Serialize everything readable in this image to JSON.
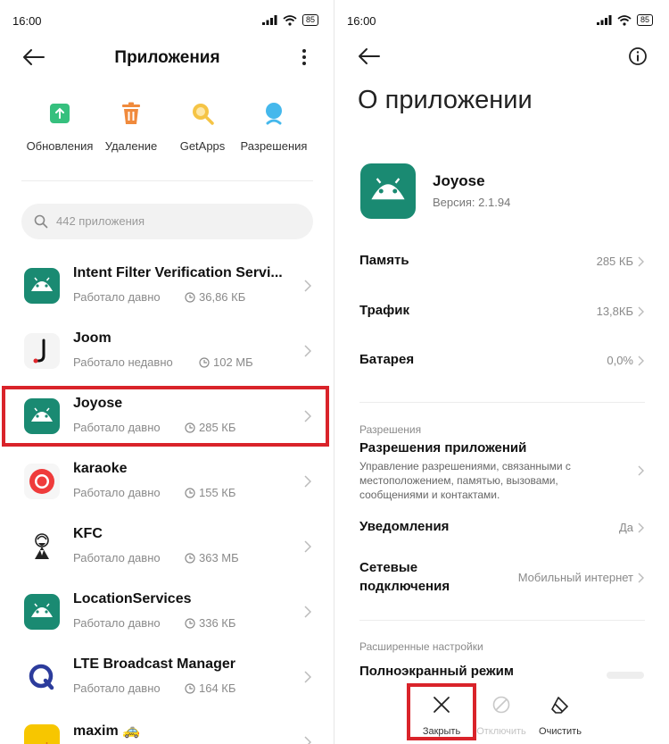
{
  "status_bar": {
    "time": "16:00",
    "battery": "85"
  },
  "left": {
    "title": "Приложения",
    "quick_actions": [
      {
        "label": "Обновления",
        "icon": "update-icon",
        "color": "#36c07e"
      },
      {
        "label": "Удаление",
        "icon": "trash-icon",
        "color": "#f08a3c"
      },
      {
        "label": "GetApps",
        "icon": "getapps-icon",
        "color": "#f5c445"
      },
      {
        "label": "Разрешения",
        "icon": "permissions-icon",
        "color": "#45b8ec"
      }
    ],
    "search_placeholder": "442 приложения",
    "apps": [
      {
        "name": "Intent Filter Verification Servi...",
        "status": "Работало давно",
        "size": "36,86 КБ",
        "icon": "android-icon"
      },
      {
        "name": "Joom",
        "status": "Работало недавно",
        "size": "102 МБ",
        "icon": "joom-icon"
      },
      {
        "name": "Joyose",
        "status": "Работало давно",
        "size": "285 КБ",
        "icon": "android-icon"
      },
      {
        "name": "karaoke",
        "status": "Работало давно",
        "size": "155 КБ",
        "icon": "karaoke-icon"
      },
      {
        "name": "KFC",
        "status": "Работало давно",
        "size": "363 МБ",
        "icon": "kfc-icon"
      },
      {
        "name": "LocationServices",
        "status": "Работало давно",
        "size": "336 КБ",
        "icon": "android-icon"
      },
      {
        "name": "LTE Broadcast Manager",
        "status": "Работало давно",
        "size": "164 КБ",
        "icon": "lte-icon"
      },
      {
        "name": "maxim 🚕",
        "status": "",
        "size": "",
        "icon": "maxim-icon",
        "logo_text": "maxim"
      }
    ]
  },
  "right": {
    "title": "О приложении",
    "app_name": "Joyose",
    "app_version": "Версия: 2.1.94",
    "rows": [
      {
        "label": "Память",
        "value": "285 КБ"
      },
      {
        "label": "Трафик",
        "value": "13,8КБ"
      },
      {
        "label": "Батарея",
        "value": "0,0%"
      }
    ],
    "permissions_section": "Разрешения",
    "permissions_title": "Разрешения приложений",
    "permissions_desc": "Управление разрешениями, связанными с местоположением, памятью, вызовами, сообщениями и контактами.",
    "notifications": {
      "label": "Уведомления",
      "value": "Да"
    },
    "network": {
      "label_line1": "Сетевые",
      "label_line2": "подключения",
      "value": "Мобильный интернет"
    },
    "advanced_section": "Расширенные настройки",
    "fullscreen": "Полноэкранный режим",
    "bottom_actions": [
      {
        "label": "Закрыть",
        "icon": "close-icon",
        "enabled": true
      },
      {
        "label": "Отключить",
        "icon": "disable-icon",
        "enabled": false
      },
      {
        "label": "Очистить",
        "icon": "eraser-icon",
        "enabled": true
      }
    ]
  },
  "colors": {
    "android_green": "#1a8a72",
    "highlight_red": "#d9232a"
  }
}
